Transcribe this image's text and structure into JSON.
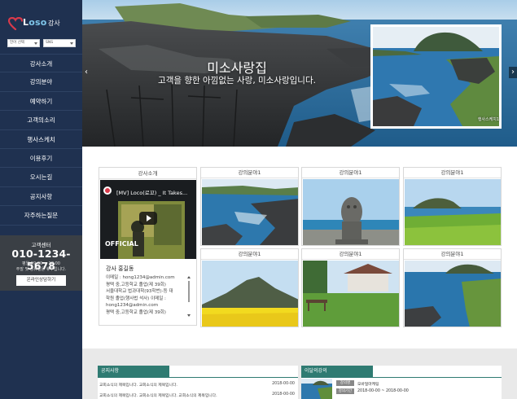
{
  "sidebar": {
    "logo": {
      "prefix": "L",
      "brand": "oso",
      "suffix": "강사"
    },
    "selects": [
      {
        "value": "언어 선택"
      },
      {
        "value": "SNS"
      }
    ],
    "nav": [
      {
        "label": "강사소개"
      },
      {
        "label": "강의분야"
      },
      {
        "label": "예약하기"
      },
      {
        "label": "고객의소리"
      },
      {
        "label": "행사스케치"
      },
      {
        "label": "이용후기"
      },
      {
        "label": "오시는길"
      },
      {
        "label": "공지사항"
      },
      {
        "label": "자주하는질문"
      }
    ],
    "customer_center": {
      "title": "고객센터",
      "phone": "010-1234-5678",
      "hours": "평일 09:00 ~ 18:00",
      "holiday": "주말 및 공휴일은 휴무입니다.",
      "button": "온라인상담하기"
    }
  },
  "hero": {
    "title": "미소사랑집",
    "subtitle": "고객을 향한 아낌없는 사랑, 미소사랑입니다.",
    "thumb_label": "행사스케치1",
    "prev_icon": "‹",
    "next_icon": "›"
  },
  "intro": {
    "header": "강사소개",
    "video_title": "[MV] Loco(로꼬) _ It Takes...",
    "video_watermark": "OFFICIAL",
    "name": "강사 홍길동",
    "info_lines": [
      "이메일 : hong1234@admin.com",
      "평택 중,고등학교 졸업(제 39회)",
      "서울대학교 법과대학(93학번)-등 대",
      "학원 졸업(행사법 석사) 이메일 :",
      "hong1234@admin.com",
      "평택 중,고등학교 졸업(제 39회)"
    ]
  },
  "gallery": [
    {
      "label": "강의분야1"
    },
    {
      "label": "강의분야1"
    },
    {
      "label": "강의분야1"
    },
    {
      "label": "강의분야1"
    },
    {
      "label": "강의분야1"
    },
    {
      "label": "강의분야1"
    }
  ],
  "notice": {
    "tab": "공지사항",
    "rows": [
      {
        "title": "교회소식의 제목입니다. 교회소식의 제목입니다.",
        "date": "2018-00-00"
      },
      {
        "title": "교회소식의 제목입니다. 교회소식의 제목입니다. 교회소식의 제목입니다.",
        "date": "2018-00-00"
      }
    ]
  },
  "lecture": {
    "tab": "이달의강의",
    "fields": [
      {
        "label": "강의명",
        "value": "오바일마케팅"
      },
      {
        "label": "강의기간",
        "value": "2018-00-00 ~ 2018-00-00"
      }
    ]
  },
  "colors": {
    "sidebar_bg": "#1f3150",
    "customer_center_bg": "#3a3f45",
    "accent_tab": "#2f7b72",
    "logo_heart": "#d83a4b",
    "logo_accent": "#7fc6ea"
  }
}
